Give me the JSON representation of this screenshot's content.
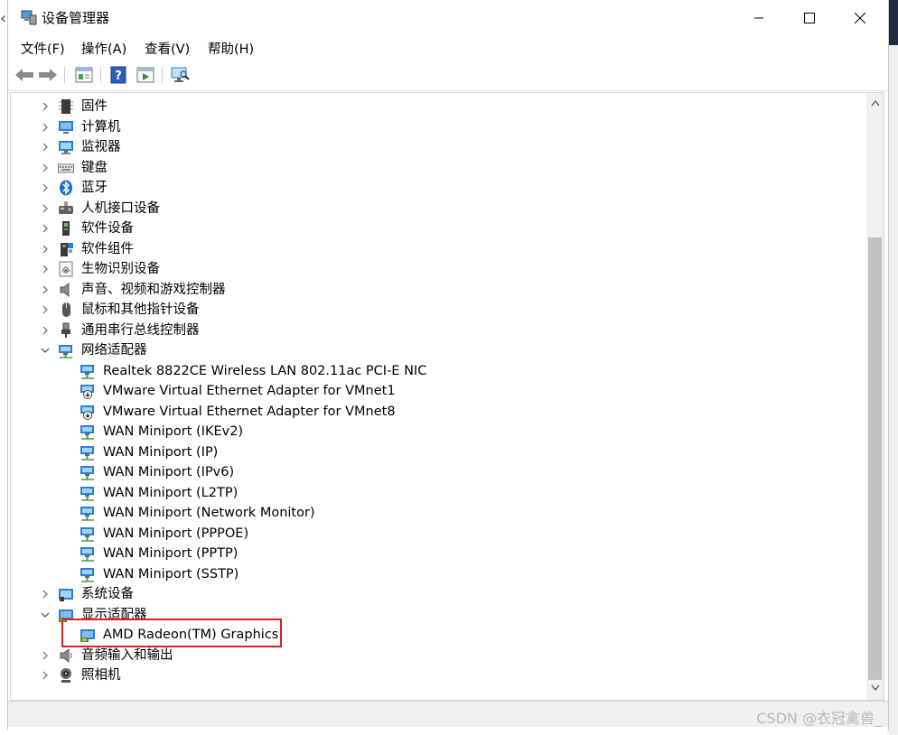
{
  "window": {
    "title": "设备管理器",
    "controls": {
      "minimize": "minimize",
      "maximize": "maximize",
      "close": "close"
    }
  },
  "menubar": {
    "items": [
      "文件(F)",
      "操作(A)",
      "查看(V)",
      "帮助(H)"
    ]
  },
  "toolbar": {
    "buttons": [
      "back-icon",
      "forward-icon",
      "properties-icon",
      "help-icon",
      "run-icon",
      "scan-icon"
    ]
  },
  "tree": {
    "nodes": [
      {
        "label": "固件",
        "icon": "firmware-icon",
        "expanded": false,
        "level": 0
      },
      {
        "label": "计算机",
        "icon": "computer-icon",
        "expanded": false,
        "level": 0
      },
      {
        "label": "监视器",
        "icon": "monitor-icon",
        "expanded": false,
        "level": 0
      },
      {
        "label": "键盘",
        "icon": "keyboard-icon",
        "expanded": false,
        "level": 0
      },
      {
        "label": "蓝牙",
        "icon": "bluetooth-icon",
        "expanded": false,
        "level": 0
      },
      {
        "label": "人机接口设备",
        "icon": "hid-icon",
        "expanded": false,
        "level": 0
      },
      {
        "label": "软件设备",
        "icon": "software-device-icon",
        "expanded": false,
        "level": 0
      },
      {
        "label": "软件组件",
        "icon": "software-component-icon",
        "expanded": false,
        "level": 0
      },
      {
        "label": "生物识别设备",
        "icon": "fingerprint-icon",
        "expanded": false,
        "level": 0
      },
      {
        "label": "声音、视频和游戏控制器",
        "icon": "speaker-icon",
        "expanded": false,
        "level": 0
      },
      {
        "label": "鼠标和其他指针设备",
        "icon": "mouse-icon",
        "expanded": false,
        "level": 0
      },
      {
        "label": "通用串行总线控制器",
        "icon": "usb-icon",
        "expanded": false,
        "level": 0
      },
      {
        "label": "网络适配器",
        "icon": "network-icon",
        "expanded": true,
        "level": 0
      },
      {
        "label": "Realtek 8822CE Wireless LAN 802.11ac PCI-E NIC",
        "icon": "network-adapter-icon",
        "level": 1
      },
      {
        "label": "VMware Virtual Ethernet Adapter for VMnet1",
        "icon": "network-adapter-disabled-icon",
        "level": 1
      },
      {
        "label": "VMware Virtual Ethernet Adapter for VMnet8",
        "icon": "network-adapter-disabled-icon",
        "level": 1
      },
      {
        "label": "WAN Miniport (IKEv2)",
        "icon": "network-adapter-icon",
        "level": 1
      },
      {
        "label": "WAN Miniport (IP)",
        "icon": "network-adapter-icon",
        "level": 1
      },
      {
        "label": "WAN Miniport (IPv6)",
        "icon": "network-adapter-icon",
        "level": 1
      },
      {
        "label": "WAN Miniport (L2TP)",
        "icon": "network-adapter-icon",
        "level": 1
      },
      {
        "label": "WAN Miniport (Network Monitor)",
        "icon": "network-adapter-icon",
        "level": 1
      },
      {
        "label": "WAN Miniport (PPPOE)",
        "icon": "network-adapter-icon",
        "level": 1
      },
      {
        "label": "WAN Miniport (PPTP)",
        "icon": "network-adapter-icon",
        "level": 1
      },
      {
        "label": "WAN Miniport (SSTP)",
        "icon": "network-adapter-icon",
        "level": 1
      },
      {
        "label": "系统设备",
        "icon": "system-device-icon",
        "expanded": false,
        "level": 0
      },
      {
        "label": "显示适配器",
        "icon": "display-adapter-icon",
        "expanded": true,
        "level": 0
      },
      {
        "label": "AMD Radeon(TM) Graphics",
        "icon": "display-adapter-icon",
        "level": 1,
        "highlighted": true
      },
      {
        "label": "音频输入和输出",
        "icon": "audio-icon",
        "expanded": false,
        "level": 0
      },
      {
        "label": "照相机",
        "icon": "camera-icon",
        "expanded": false,
        "level": 0
      }
    ]
  },
  "watermark": "CSDN @衣冠禽兽_",
  "colors": {
    "highlight": "#e02020",
    "icon_blue": "#2f7fd1",
    "scroll_thumb": "#c1c1c1"
  }
}
